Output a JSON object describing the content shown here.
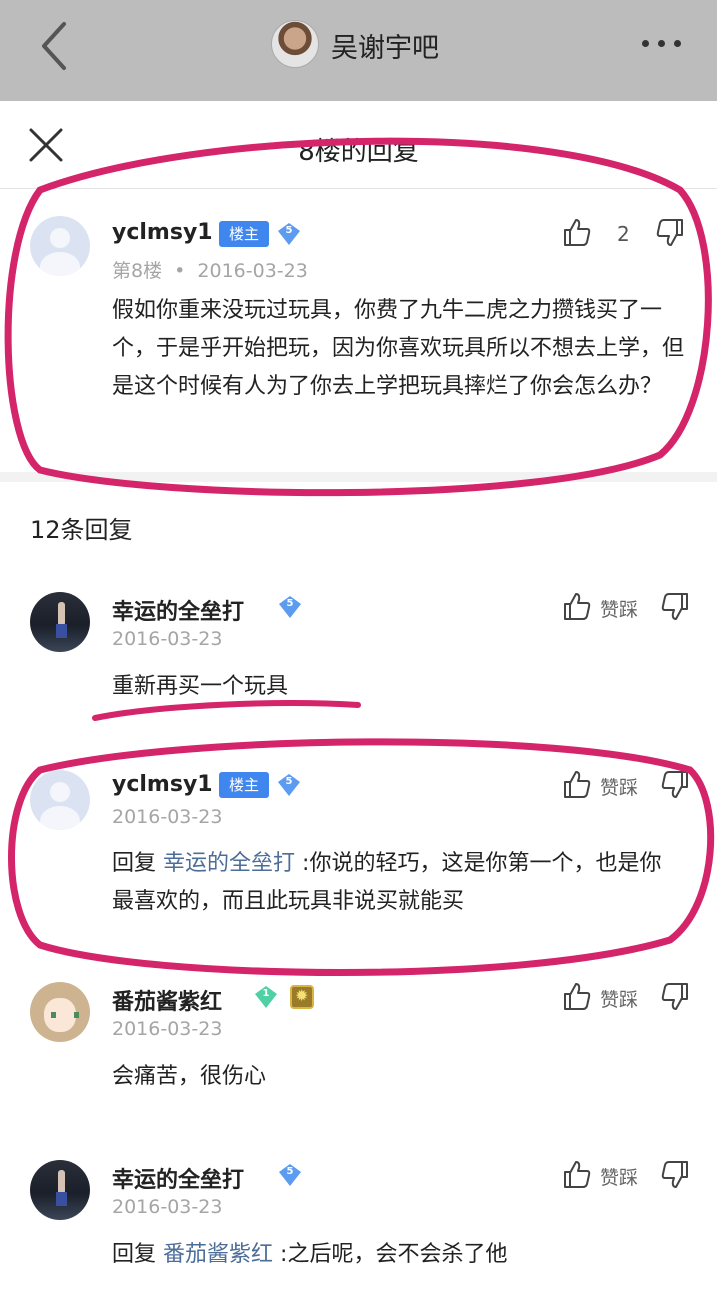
{
  "topbar": {
    "forum_name": "吴谢宇吧",
    "back_icon": "chevron-left-icon",
    "more_icon": "more-dots-icon"
  },
  "sheet": {
    "title": "8楼的回复",
    "close_icon": "close-icon"
  },
  "main_post": {
    "username": "yclmsy1",
    "owner_tag": "楼主",
    "level": "5",
    "floor": "第8楼",
    "separator": "•",
    "date": "2016-03-23",
    "likes": "2",
    "content": "假如你重来没玩过玩具，你费了九牛二虎之力攒钱买了一个，于是乎开始把玩，因为你喜欢玩具所以不想去上学，但是这个时候有人为了你去上学把玩具摔烂了你会怎么办？"
  },
  "reply_count_label": "12条回复",
  "action_label": "赞踩",
  "replies": [
    {
      "username": "幸运的全垒打",
      "level": "5",
      "date": "2016-03-23",
      "content": "重新再买一个玩具"
    },
    {
      "username": "yclmsy1",
      "owner_tag": "楼主",
      "level": "5",
      "date": "2016-03-23",
      "reply_prefix": "回复",
      "reply_to": "幸运的全垒打",
      "content": ":你说的轻巧，这是你第一个，也是你最喜欢的，而且此玩具非说买就能买"
    },
    {
      "username": "番茄酱紫红",
      "level": "1",
      "date": "2016-03-23",
      "content": "会痛苦，很伤心"
    },
    {
      "username": "幸运的全垒打",
      "level": "5",
      "date": "2016-03-23",
      "reply_prefix": "回复",
      "reply_to": "番茄酱紫红",
      "content": ":之后呢，会不会杀了他"
    }
  ],
  "colors": {
    "topbar_bg": "#bcbcbc",
    "owner_tag_bg": "#3f86ee",
    "level_badge_blue": "#5b9bf0",
    "level_badge_green": "#4fd1a5",
    "annotation_ink": "#d4246a",
    "link_text": "#4d6d99"
  }
}
